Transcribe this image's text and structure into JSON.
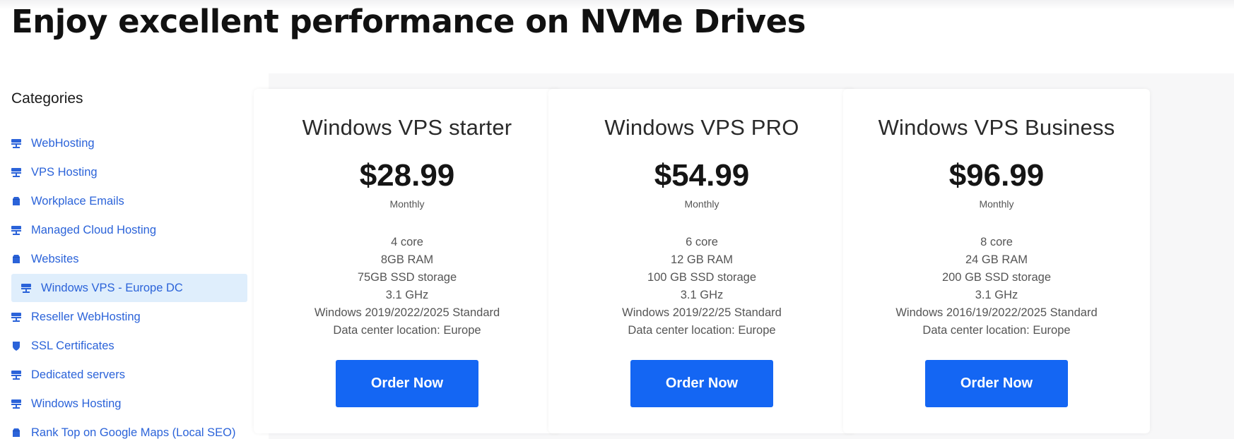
{
  "page": {
    "title": "Enjoy excellent performance on NVMe Drives",
    "accent_color": "#1466f3",
    "link_color": "#2b63d9",
    "active_bg": "#dfeefc"
  },
  "sidebar": {
    "heading": "Categories",
    "items": [
      {
        "label": "WebHosting",
        "icon": "server-icon",
        "active": false
      },
      {
        "label": "VPS Hosting",
        "icon": "server-icon",
        "active": false
      },
      {
        "label": "Workplace Emails",
        "icon": "box-icon",
        "active": false
      },
      {
        "label": "Managed Cloud Hosting",
        "icon": "server-icon",
        "active": false
      },
      {
        "label": "Websites",
        "icon": "box-icon",
        "active": false
      },
      {
        "label": "Windows VPS - Europe DC",
        "icon": "server-icon",
        "active": true
      },
      {
        "label": "Reseller WebHosting",
        "icon": "server-icon",
        "active": false
      },
      {
        "label": "SSL Certificates",
        "icon": "shield-icon",
        "active": false
      },
      {
        "label": "Dedicated servers",
        "icon": "server-icon",
        "active": false
      },
      {
        "label": "Windows Hosting",
        "icon": "server-icon",
        "active": false
      },
      {
        "label": "Rank Top on Google Maps (Local SEO)",
        "icon": "box-icon",
        "active": false
      }
    ]
  },
  "plans": [
    {
      "name": "Windows VPS starter",
      "price": "$28.99",
      "period": "Monthly",
      "features": [
        "4 core",
        "8GB RAM",
        "75GB SSD storage",
        "3.1 GHz",
        "Windows 2019/2022/2025 Standard",
        "Data center location: Europe"
      ],
      "button": "Order Now"
    },
    {
      "name": "Windows VPS PRO",
      "price": "$54.99",
      "period": "Monthly",
      "features": [
        "6 core",
        "12 GB RAM",
        "100 GB SSD storage",
        "3.1 GHz",
        "Windows 2019/22/25 Standard",
        "Data center location: Europe"
      ],
      "button": "Order Now"
    },
    {
      "name": "Windows VPS Business",
      "price": "$96.99",
      "period": "Monthly",
      "features": [
        "8 core",
        "24 GB RAM",
        "200 GB SSD storage",
        "3.1 GHz",
        "Windows 2016/19/2022/2025 Standard",
        "Data center location: Europe"
      ],
      "button": "Order Now"
    }
  ]
}
